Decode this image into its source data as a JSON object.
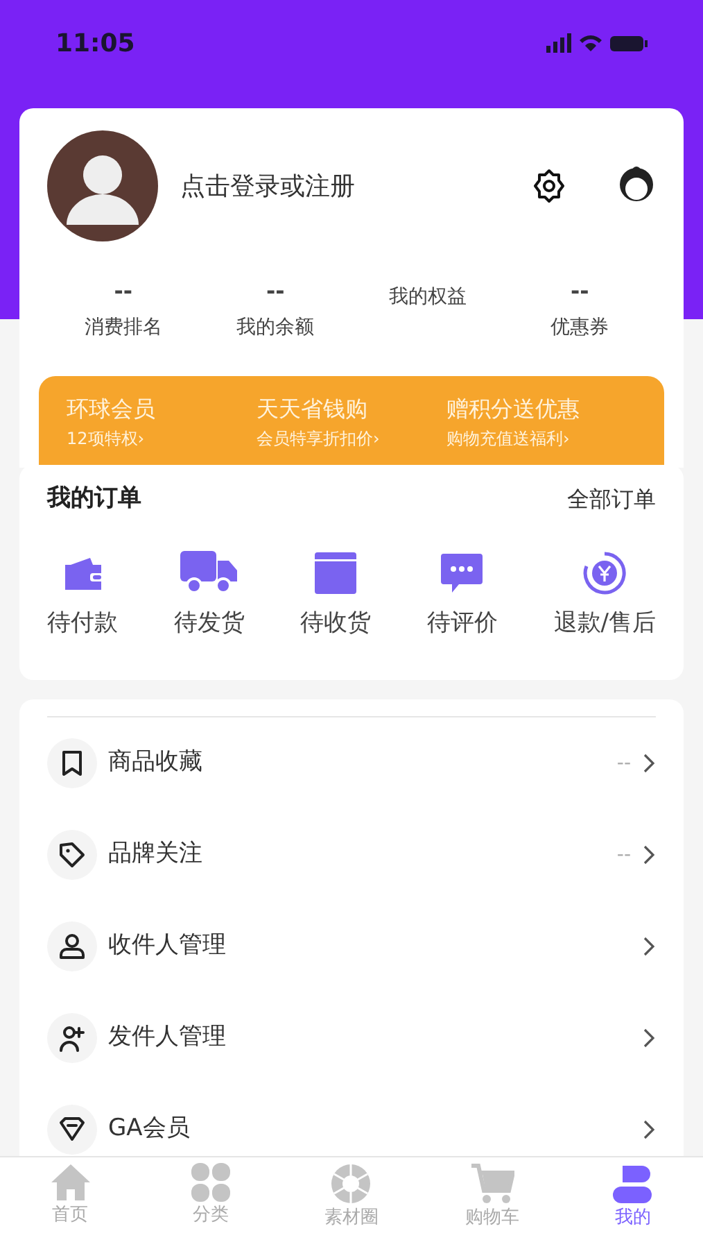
{
  "status_bar": {
    "time": "11:05"
  },
  "profile": {
    "login_prompt": "点击登录或注册"
  },
  "stats": [
    {
      "value": "--",
      "label": "消费排名"
    },
    {
      "value": "--",
      "label": "我的余额"
    },
    {
      "label": "我的权益"
    },
    {
      "value": "--",
      "label": "优惠券"
    }
  ],
  "promo_banner": [
    {
      "title": "环球会员",
      "subtitle": "12项特权›"
    },
    {
      "title": "天天省钱购",
      "subtitle": "会员特享折扣价›"
    },
    {
      "title": "赠积分送优惠",
      "subtitle": "购物充值送福利›"
    }
  ],
  "orders": {
    "title": "我的订单",
    "all_link": "全部订单",
    "items": [
      {
        "kind": "wallet",
        "label": "待付款"
      },
      {
        "kind": "truck",
        "label": "待发货"
      },
      {
        "kind": "box",
        "label": "待收货"
      },
      {
        "kind": "chat",
        "label": "待评价"
      },
      {
        "kind": "refund",
        "label": "退款/售后"
      }
    ]
  },
  "menu": [
    {
      "kind": "bookmark",
      "label": "商品收藏",
      "value": "--"
    },
    {
      "kind": "tag",
      "label": "品牌关注",
      "value": "--"
    },
    {
      "kind": "person",
      "label": "收件人管理"
    },
    {
      "kind": "person-add",
      "label": "发件人管理"
    },
    {
      "kind": "diamond",
      "label": "GA会员"
    }
  ],
  "tab_bar": [
    {
      "kind": "home",
      "label": "首页",
      "selected": false
    },
    {
      "kind": "grid",
      "label": "分类",
      "selected": false
    },
    {
      "kind": "aperture",
      "label": "素材圈",
      "selected": false
    },
    {
      "kind": "cart",
      "label": "购物车",
      "selected": false
    },
    {
      "kind": "me",
      "label": "我的",
      "selected": true
    }
  ]
}
